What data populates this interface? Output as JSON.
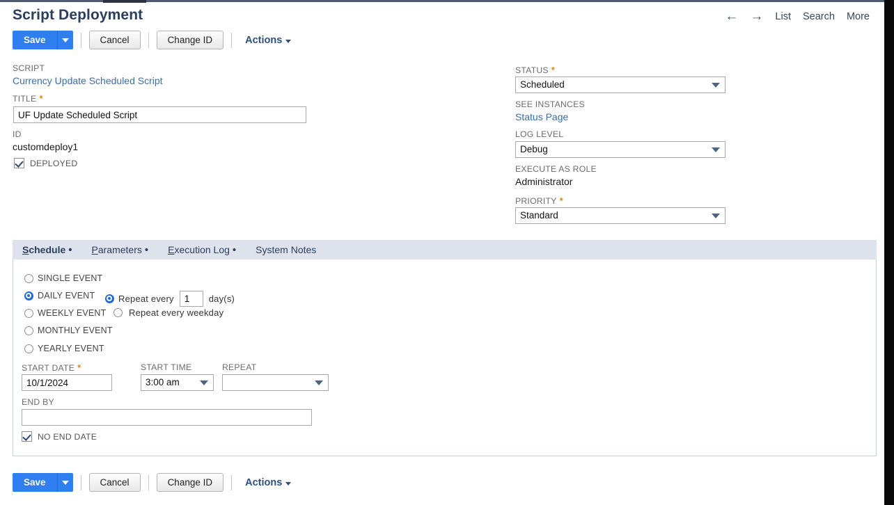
{
  "header": {
    "title": "Script Deployment",
    "nav": {
      "back_icon": "arrow-left-icon",
      "forward_icon": "arrow-right-icon",
      "list": "List",
      "search": "Search",
      "more": "More"
    },
    "buttons": {
      "save": "Save",
      "save_dropdown_icon": "chevron-down-icon",
      "cancel": "Cancel",
      "change_id": "Change ID",
      "actions": "Actions",
      "actions_caret_icon": "caret-down-icon"
    }
  },
  "form": {
    "script": {
      "label": "SCRIPT",
      "value": "Currency Update Scheduled Script"
    },
    "title": {
      "label": "TITLE",
      "required": "*",
      "value": "UF Update Scheduled Script"
    },
    "id": {
      "label": "ID",
      "value": "customdeploy1"
    },
    "deployed": {
      "label": "DEPLOYED",
      "checked": true
    },
    "status": {
      "label": "STATUS",
      "required": "*",
      "value": "Scheduled"
    },
    "see_instances": {
      "label": "SEE INSTANCES",
      "value": "Status Page"
    },
    "log_level": {
      "label": "LOG LEVEL",
      "value": "Debug"
    },
    "execute_as_role": {
      "label": "EXECUTE AS ROLE",
      "value": "Administrator"
    },
    "priority": {
      "label": "PRIORITY",
      "required": "*",
      "value": "Standard"
    }
  },
  "tabs": [
    {
      "label": "Schedule",
      "accesskey": "S",
      "rest": "chedule",
      "bullet": "•",
      "active": true
    },
    {
      "label": "Parameters",
      "accesskey": "P",
      "rest": "arameters",
      "bullet": "•",
      "active": false
    },
    {
      "label": "Execution Log",
      "accesskey": "E",
      "rest": "xecution Log",
      "bullet": "•",
      "active": false
    },
    {
      "label": "System Notes",
      "accesskey": "",
      "rest": "System Notes",
      "bullet": "",
      "active": false
    }
  ],
  "schedule": {
    "event_types": [
      {
        "label": "SINGLE EVENT",
        "selected": false
      },
      {
        "label": "DAILY EVENT",
        "selected": true
      },
      {
        "label": "WEEKLY EVENT",
        "selected": false
      },
      {
        "label": "MONTHLY EVENT",
        "selected": false
      },
      {
        "label": "YEARLY EVENT",
        "selected": false
      }
    ],
    "repeat_every": {
      "label": "Repeat every",
      "value": "1",
      "unit": "day(s)",
      "selected": true
    },
    "repeat_weekday": {
      "label": "Repeat every weekday",
      "selected": false
    },
    "start_date": {
      "label": "START DATE",
      "required": "*",
      "value": "10/1/2024"
    },
    "start_time": {
      "label": "START TIME",
      "value": "3:00 am"
    },
    "repeat": {
      "label": "REPEAT",
      "value": ""
    },
    "end_by": {
      "label": "END BY",
      "value": ""
    },
    "no_end_date": {
      "label": "NO END DATE",
      "checked": true
    }
  },
  "footer": {
    "save": "Save",
    "save_dropdown_icon": "chevron-down-icon",
    "cancel": "Cancel",
    "change_id": "Change ID",
    "actions": "Actions",
    "actions_caret_icon": "caret-down-icon"
  }
}
